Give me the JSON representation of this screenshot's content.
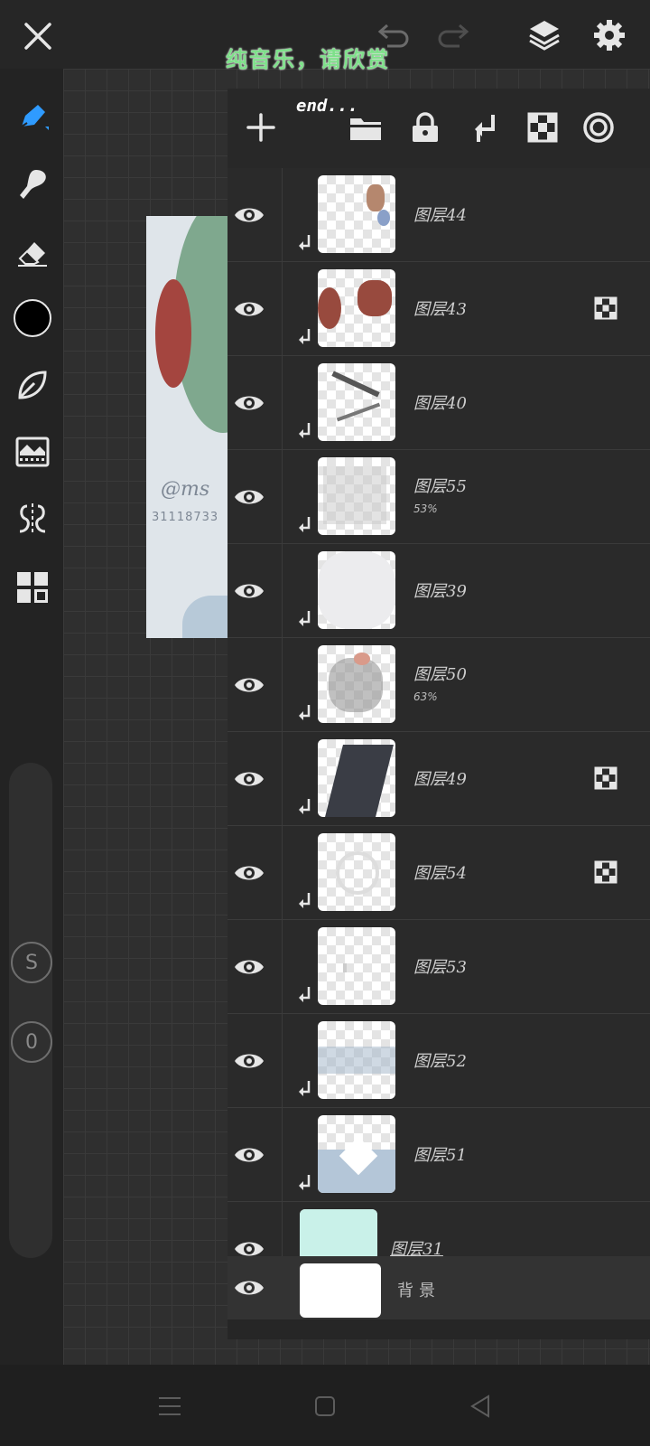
{
  "overlay": {
    "title": "纯音乐，请欣赏",
    "subtitle": "end..."
  },
  "topbar": {
    "close": "close",
    "undo": "undo",
    "redo": "redo",
    "layers": "layers",
    "settings": "settings"
  },
  "left_toolbar": {
    "tools": [
      "pen-tool",
      "blur-tool",
      "eraser-tool",
      "color-picker",
      "leaf-tool",
      "filter-tool",
      "symmetry-tool",
      "apps-tool"
    ],
    "size_badge": "S",
    "opacity_badge": "0",
    "current_color": "#000000"
  },
  "artwork": {
    "signature": "@ms",
    "signature_number": "31118733"
  },
  "layers_panel": {
    "toolbar_icons": [
      "add-icon",
      "folder-icon",
      "lock-icon",
      "merge-down-icon",
      "alpha-lock-icon",
      "mask-target-icon"
    ],
    "layers": [
      {
        "name": "图层44",
        "opacity": "",
        "clipped": true,
        "mask": false
      },
      {
        "name": "图层43",
        "opacity": "",
        "clipped": true,
        "mask": true
      },
      {
        "name": "图层40",
        "opacity": "",
        "clipped": true,
        "mask": false
      },
      {
        "name": "图层55",
        "opacity": "53%",
        "clipped": true,
        "mask": false
      },
      {
        "name": "图层39",
        "opacity": "",
        "clipped": true,
        "mask": false
      },
      {
        "name": "图层50",
        "opacity": "63%",
        "clipped": true,
        "mask": false
      },
      {
        "name": "图层49",
        "opacity": "",
        "clipped": true,
        "mask": true
      },
      {
        "name": "图层54",
        "opacity": "",
        "clipped": true,
        "mask": true
      },
      {
        "name": "图层53",
        "opacity": "",
        "clipped": true,
        "mask": false
      },
      {
        "name": "图层52",
        "opacity": "",
        "clipped": true,
        "mask": false
      },
      {
        "name": "图层51",
        "opacity": "",
        "clipped": true,
        "mask": false
      },
      {
        "name": "图层31",
        "opacity": "",
        "clipped": false,
        "mask": false
      }
    ],
    "background_layer": "背景"
  },
  "navbar": {
    "menu": "menu",
    "home": "home",
    "back": "back"
  }
}
